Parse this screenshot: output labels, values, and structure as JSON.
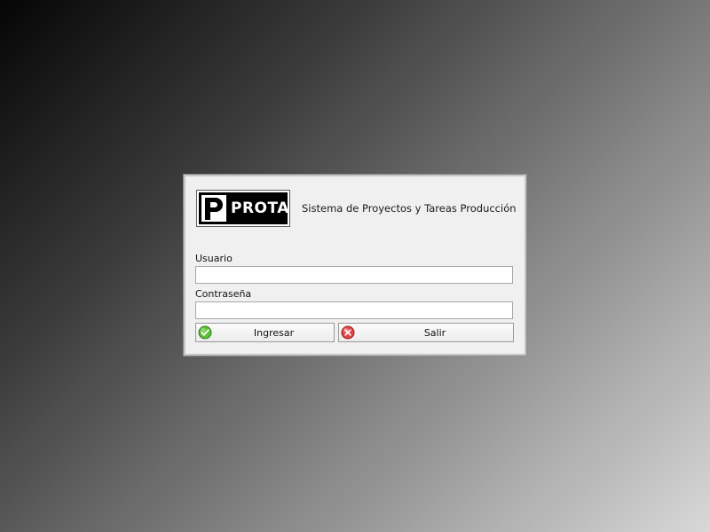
{
  "logo": {
    "mark": "P",
    "word": "PROTA"
  },
  "header": {
    "subtitle": "Sistema de Proyectos y Tareas Producción"
  },
  "form": {
    "username_label": "Usuario",
    "username_value": "",
    "password_label": "Contraseña",
    "password_value": ""
  },
  "buttons": {
    "login": {
      "label": "Ingresar",
      "icon": "check-icon",
      "color": "#4caf2a"
    },
    "exit": {
      "label": "Salir",
      "icon": "close-icon",
      "color": "#d32b2b"
    }
  }
}
